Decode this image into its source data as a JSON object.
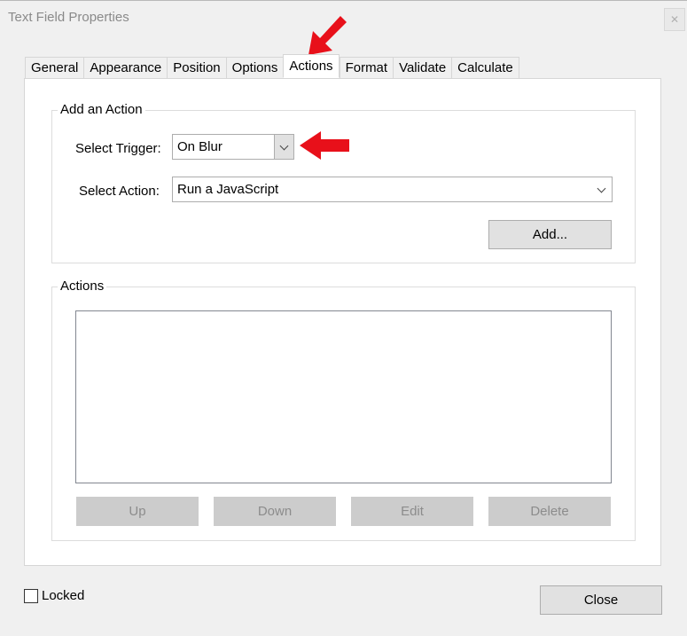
{
  "window": {
    "title": "Text Field Properties",
    "close_glyph": "✕"
  },
  "tabs": [
    {
      "label": "General",
      "active": false
    },
    {
      "label": "Appearance",
      "active": false
    },
    {
      "label": "Position",
      "active": false
    },
    {
      "label": "Options",
      "active": false
    },
    {
      "label": "Actions",
      "active": true
    },
    {
      "label": "Format",
      "active": false
    },
    {
      "label": "Validate",
      "active": false
    },
    {
      "label": "Calculate",
      "active": false
    }
  ],
  "add_action": {
    "group_label": "Add an Action",
    "trigger_label": "Select Trigger:",
    "trigger_value": "On Blur",
    "action_label": "Select Action:",
    "action_value": "Run a JavaScript",
    "add_button": "Add..."
  },
  "actions": {
    "group_label": "Actions",
    "items": [],
    "buttons": {
      "up": "Up",
      "down": "Down",
      "edit": "Edit",
      "delete": "Delete"
    }
  },
  "footer": {
    "locked_label": "Locked",
    "locked_checked": false,
    "close_button": "Close"
  },
  "annotations": {
    "arrow_color": "#e8101a"
  }
}
